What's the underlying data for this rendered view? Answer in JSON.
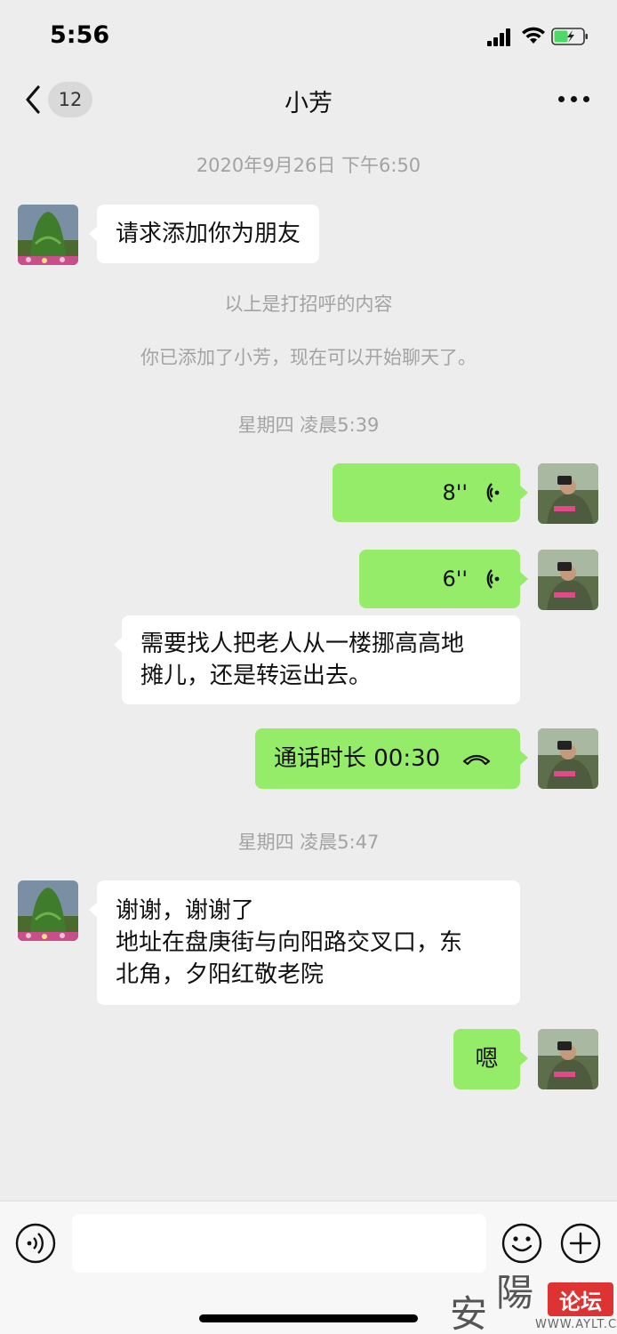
{
  "status_bar": {
    "time": "5:56"
  },
  "nav": {
    "unread_count": "12",
    "title": "小芳"
  },
  "chat": {
    "timestamp_1": "2020年9月26日 下午6:50",
    "friend_request": "请求添加你为朋友",
    "system_1": "以上是打招呼的内容",
    "system_2": "你已添加了小芳，现在可以开始聊天了。",
    "timestamp_2": "星期四 凌晨5:39",
    "voice_1": "8''",
    "voice_2": "6''",
    "incoming_2_line1": "需要找人把老人从一楼挪高高地",
    "incoming_2_line2": "摊儿，还是转运出去。",
    "call_text": "通话时长 00:30",
    "timestamp_3": "星期四 凌晨5:47",
    "incoming_3_line1": "谢谢，谢谢了",
    "incoming_3_line2": "地址在盘庚街与向阳路交叉口，东",
    "incoming_3_line3": "北角，夕阳红敬老院",
    "outgoing_last": "嗯"
  },
  "watermark": {
    "char_1": "安",
    "char_2": "陽",
    "badge": "论坛",
    "url": "WWW.AYLT.CN"
  },
  "colors": {
    "background": "#ededed",
    "outgoing_bubble": "#95ec69",
    "incoming_bubble": "#ffffff",
    "meta_text": "#a3a3a3"
  },
  "icons": [
    "back-icon",
    "more-icon",
    "voice-wave-icon",
    "phone-hangup-icon",
    "voice-input-icon",
    "emoji-icon",
    "plus-icon",
    "signal-icon",
    "wifi-icon",
    "battery-icon"
  ]
}
